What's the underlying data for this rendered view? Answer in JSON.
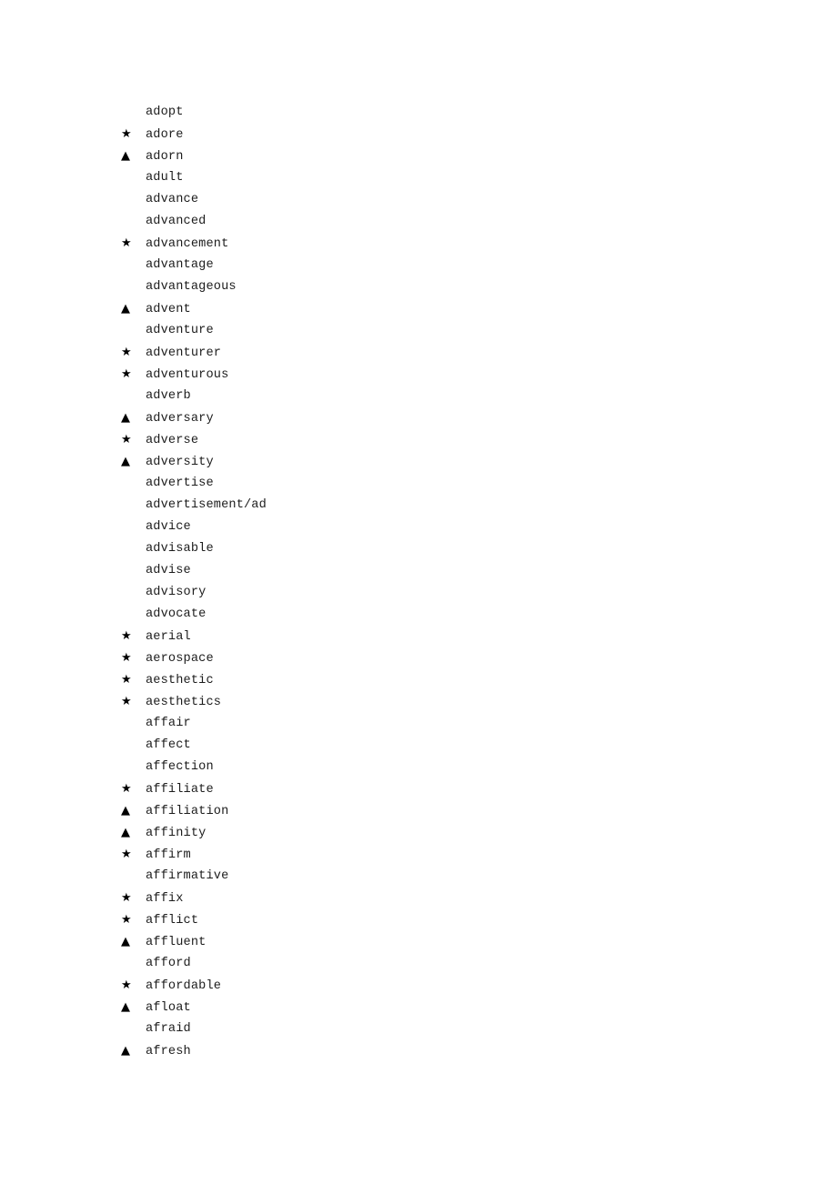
{
  "page": {
    "background_color": "#ffffff",
    "text_color": "#1c1c1c",
    "marker_color": "#000000"
  },
  "markers": {
    "star": "★",
    "triangle": "▲",
    "none": ""
  },
  "word_list": {
    "entries": [
      {
        "marker": "none",
        "word": "adopt"
      },
      {
        "marker": "star",
        "word": "adore"
      },
      {
        "marker": "triangle",
        "word": "adorn"
      },
      {
        "marker": "none",
        "word": "adult"
      },
      {
        "marker": "none",
        "word": "advance"
      },
      {
        "marker": "none",
        "word": "advanced"
      },
      {
        "marker": "star",
        "word": "advancement"
      },
      {
        "marker": "none",
        "word": "advantage"
      },
      {
        "marker": "none",
        "word": "advantageous"
      },
      {
        "marker": "triangle",
        "word": "advent"
      },
      {
        "marker": "none",
        "word": "adventure"
      },
      {
        "marker": "star",
        "word": "adventurer"
      },
      {
        "marker": "star",
        "word": "adventurous"
      },
      {
        "marker": "none",
        "word": "adverb"
      },
      {
        "marker": "triangle",
        "word": "adversary"
      },
      {
        "marker": "star",
        "word": "adverse"
      },
      {
        "marker": "triangle",
        "word": "adversity"
      },
      {
        "marker": "none",
        "word": "advertise"
      },
      {
        "marker": "none",
        "word": "advertisement/ad"
      },
      {
        "marker": "none",
        "word": "advice"
      },
      {
        "marker": "none",
        "word": "advisable"
      },
      {
        "marker": "none",
        "word": "advise"
      },
      {
        "marker": "none",
        "word": "advisory"
      },
      {
        "marker": "none",
        "word": "advocate"
      },
      {
        "marker": "star",
        "word": "aerial"
      },
      {
        "marker": "star",
        "word": "aerospace"
      },
      {
        "marker": "star",
        "word": "aesthetic"
      },
      {
        "marker": "star",
        "word": "aesthetics"
      },
      {
        "marker": "none",
        "word": "affair"
      },
      {
        "marker": "none",
        "word": "affect"
      },
      {
        "marker": "none",
        "word": "affection"
      },
      {
        "marker": "star",
        "word": "affiliate"
      },
      {
        "marker": "triangle",
        "word": "affiliation"
      },
      {
        "marker": "triangle",
        "word": "affinity"
      },
      {
        "marker": "star",
        "word": "affirm"
      },
      {
        "marker": "none",
        "word": "affirmative"
      },
      {
        "marker": "star",
        "word": "affix"
      },
      {
        "marker": "star",
        "word": "afflict"
      },
      {
        "marker": "triangle",
        "word": "affluent"
      },
      {
        "marker": "none",
        "word": "afford"
      },
      {
        "marker": "star",
        "word": "affordable"
      },
      {
        "marker": "triangle",
        "word": "afloat"
      },
      {
        "marker": "none",
        "word": "afraid"
      },
      {
        "marker": "triangle",
        "word": "afresh"
      }
    ]
  }
}
